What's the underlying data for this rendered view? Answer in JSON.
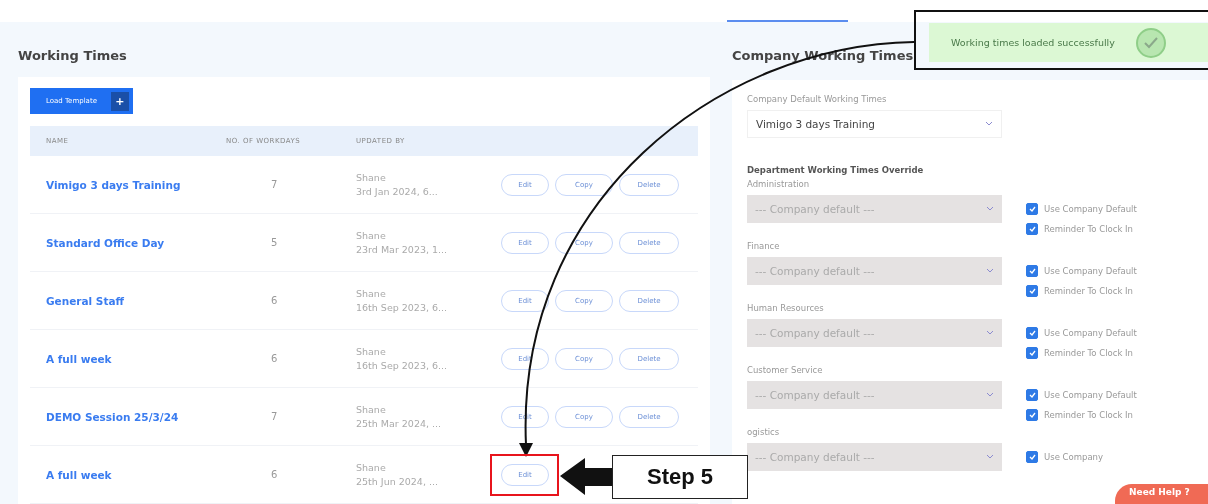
{
  "left_panel": {
    "title": "Working Times",
    "load_button": "Load Template",
    "load_icon": "+",
    "columns": [
      "NAME",
      "NO. OF WORKDAYS",
      "UPDATED BY"
    ],
    "rows": [
      {
        "name": "Vimigo 3 days Training",
        "workdays": "7",
        "user": "Shane",
        "date": "3rd Jan 2024, 6...",
        "actions": [
          "Edit",
          "Copy",
          "Delete"
        ]
      },
      {
        "name": "Standard Office Day",
        "workdays": "5",
        "user": "Shane",
        "date": "23rd Mar 2023, 1...",
        "actions": [
          "Edit",
          "Copy",
          "Delete"
        ]
      },
      {
        "name": "General Staff",
        "workdays": "6",
        "user": "Shane",
        "date": "16th Sep 2023, 6...",
        "actions": [
          "Edit",
          "Copy",
          "Delete"
        ]
      },
      {
        "name": "A full week",
        "workdays": "6",
        "user": "Shane",
        "date": "16th Sep 2023, 6...",
        "actions": [
          "Edit",
          "Copy",
          "Delete"
        ]
      },
      {
        "name": "DEMO Session 25/3/24",
        "workdays": "7",
        "user": "Shane",
        "date": "25th Mar 2024, ...",
        "actions": [
          "Edit",
          "Copy",
          "Delete"
        ]
      },
      {
        "name": "A full week",
        "workdays": "6",
        "user": "Shane",
        "date": "25th Jun 2024, ...",
        "actions": [
          "Edit"
        ]
      }
    ]
  },
  "right_panel": {
    "title": "Company Working Times",
    "default_label": "Company Default Working Times",
    "default_value": "Vimigo 3 days Training",
    "override_title": "Department Working Times Override",
    "departments": [
      {
        "name": "Administration",
        "value": "--- Company default ---",
        "options": [
          {
            "label": "Use Company Default",
            "checked": true
          },
          {
            "label": "Reminder To Clock In",
            "checked": true
          }
        ]
      },
      {
        "name": "Finance",
        "value": "--- Company default ---",
        "options": [
          {
            "label": "Use Company Default",
            "checked": true
          },
          {
            "label": "Reminder To Clock In",
            "checked": true
          }
        ]
      },
      {
        "name": "Human Resources",
        "value": "--- Company default ---",
        "options": [
          {
            "label": "Use Company Default",
            "checked": true
          },
          {
            "label": "Reminder To Clock In",
            "checked": true
          }
        ]
      },
      {
        "name": "Customer Service",
        "value": "--- Company default ---",
        "options": [
          {
            "label": "Use Company Default",
            "checked": true
          },
          {
            "label": "Reminder To Clock In",
            "checked": true
          }
        ]
      },
      {
        "name": "ogistics",
        "value": "--- Company default ---",
        "options": [
          {
            "label": "Use Company",
            "checked": true
          }
        ]
      }
    ]
  },
  "toast": {
    "message": "Working times loaded successfully"
  },
  "step_callout": "Step 5",
  "help_button": "Need Help ?"
}
